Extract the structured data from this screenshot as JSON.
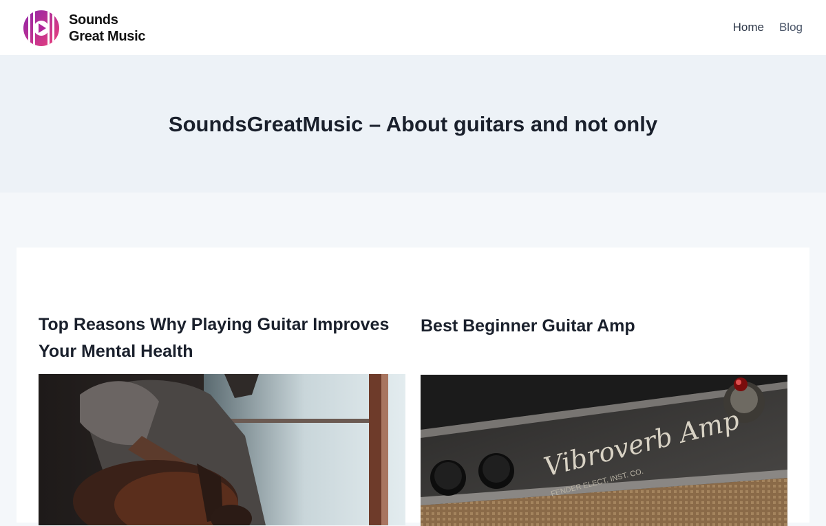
{
  "site": {
    "name_line1": "Sounds",
    "name_line2": "Great Music"
  },
  "nav": {
    "items": [
      {
        "label": "Home"
      },
      {
        "label": "Blog"
      }
    ]
  },
  "hero": {
    "title": "SoundsGreatMusic – About guitars and not only"
  },
  "posts": [
    {
      "title": "Top Reasons Why Playing Guitar Improves Your Mental Health"
    },
    {
      "title": "Best Beginner Guitar Amp",
      "image_text": "Vibroverb Amp",
      "image_subtext": "FENDER ELECT. INST. CO."
    }
  ],
  "colors": {
    "logo_gradient_start": "#8e24aa",
    "logo_gradient_end": "#ec407a",
    "hero_bg": "#edf2f7",
    "page_bg": "#f4f7fa"
  }
}
